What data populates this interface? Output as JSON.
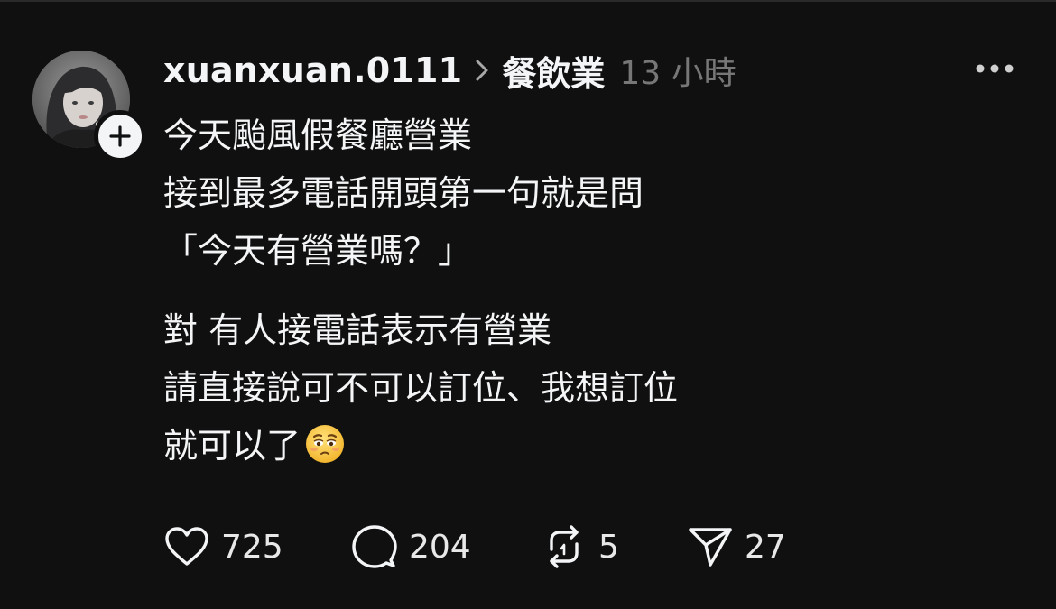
{
  "post": {
    "username": "xuanxuan.0111",
    "topic": "餐飲業",
    "time": "13 小時",
    "paragraphs": [
      [
        "今天颱風假餐廳營業",
        "接到最多電話開頭第一句就是問",
        "「今天有營業嗎？」"
      ],
      [
        "對 有人接電話表示有營業",
        "請直接說可不可以訂位、我想訂位",
        "就可以了"
      ]
    ],
    "trailing_emoji": "pleading-face",
    "actions": {
      "likes": "725",
      "comments": "204",
      "reposts": "5",
      "shares": "27"
    }
  },
  "colors": {
    "background": "#101010",
    "text": "#f3f5f7",
    "muted": "#777777",
    "emoji": "#f7c23b"
  },
  "icons": {
    "more": "more-horizontal-icon",
    "follow": "plus-icon",
    "chevron": "chevron-right-icon",
    "like": "heart-icon",
    "comment": "comment-bubble-icon",
    "repost": "repost-icon",
    "share": "send-icon"
  }
}
